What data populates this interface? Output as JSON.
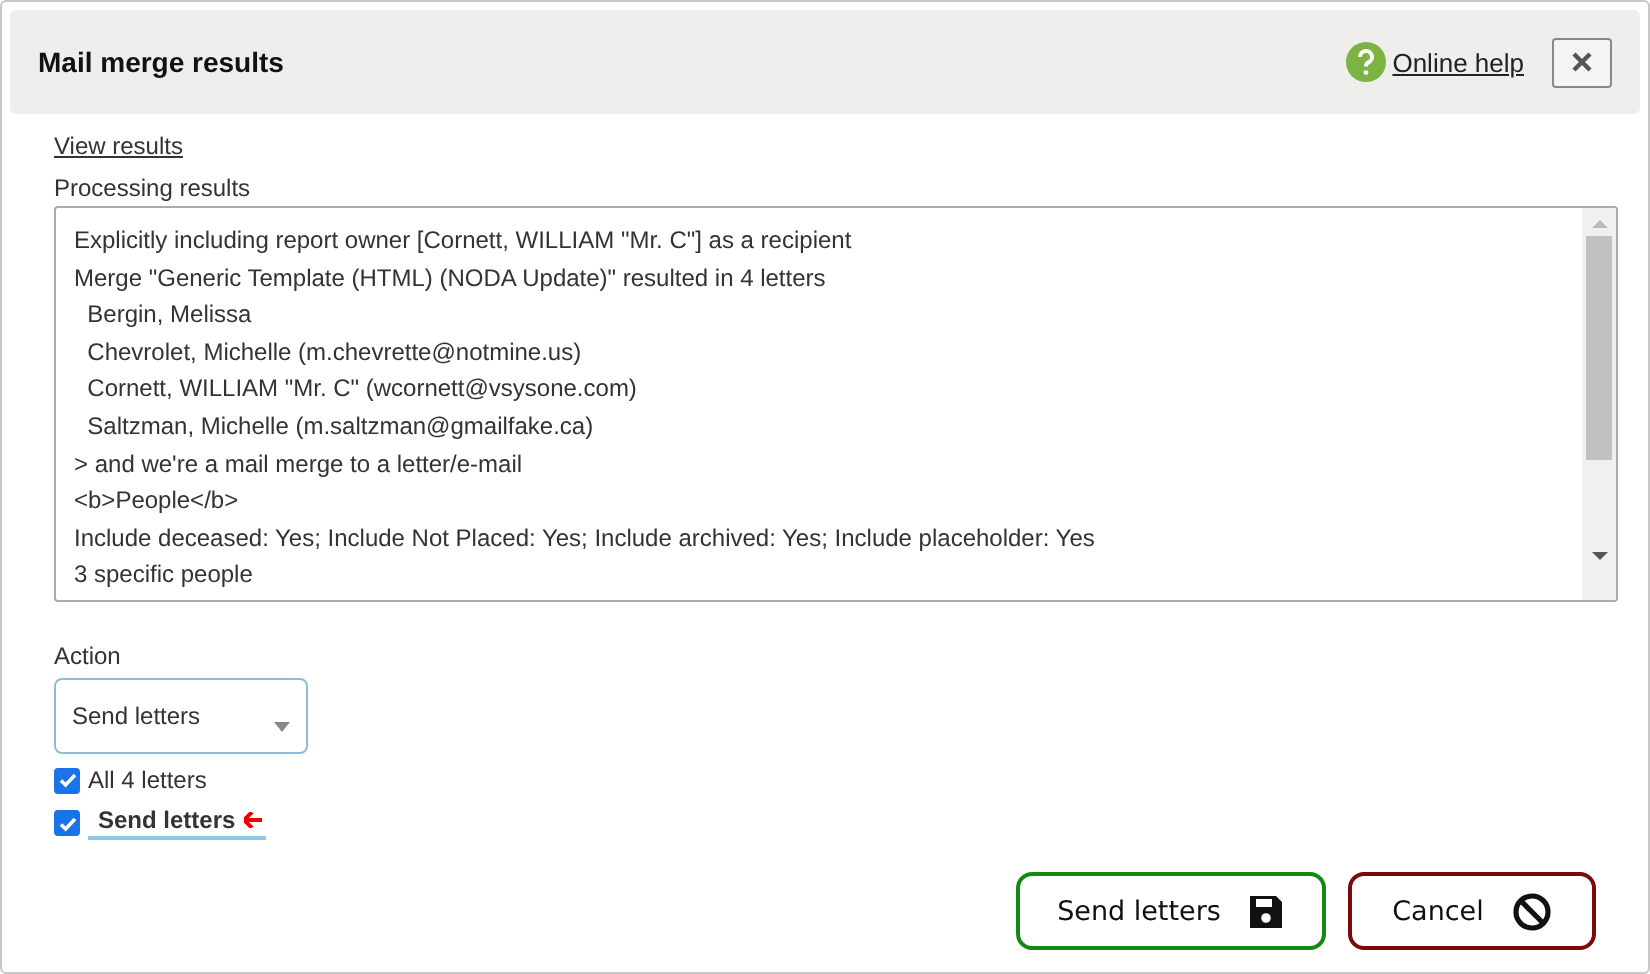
{
  "dialog": {
    "title": "Mail merge results",
    "help_link": "Online help"
  },
  "view_results_link": "View results",
  "processing": {
    "label": "Processing results",
    "lines": [
      "Explicitly including report owner [Cornett, WILLIAM \"Mr. C\"] as a recipient",
      "Merge \"Generic Template (HTML) (NODA Update)\" resulted in 4 letters",
      "  Bergin, Melissa",
      "  Chevrolet, Michelle (m.chevrette@notmine.us)",
      "  Cornett, WILLIAM \"Mr. C\" (wcornett@vsysone.com)",
      "  Saltzman, Michelle (m.saltzman@gmailfake.ca)",
      "> and we're a mail merge to a letter/e-mail",
      "<b>People</b>",
      "Include deceased: Yes; Include Not Placed: Yes; Include archived: Yes; Include placeholder: Yes",
      "3 specific people"
    ]
  },
  "action": {
    "label": "Action",
    "value": "Send letters"
  },
  "options": [
    {
      "kind": "plain",
      "label": "All 4 letters",
      "checked": true
    },
    {
      "kind": "highlighted",
      "label": "Send letters",
      "checked": true
    }
  ],
  "buttons": [
    {
      "kind": "save",
      "label": "Send letters"
    },
    {
      "kind": "cancel",
      "label": "Cancel"
    }
  ]
}
